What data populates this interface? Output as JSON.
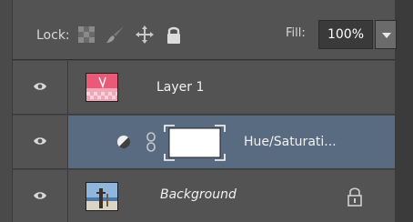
{
  "toolbar": {
    "lock_label": "Lock:",
    "fill_label": "Fill:",
    "fill_value": "100%",
    "icons": [
      "lock-transparent-pixels-icon",
      "lock-image-pixels-icon",
      "lock-position-icon",
      "lock-all-icon"
    ]
  },
  "layers": [
    {
      "name": "Layer 1",
      "visible": true,
      "selected": false,
      "italic": false
    },
    {
      "name": "Hue/Saturati...",
      "visible": true,
      "selected": true,
      "italic": false,
      "adjustment": true
    },
    {
      "name": "Background",
      "visible": true,
      "selected": false,
      "italic": true,
      "locked": true
    }
  ],
  "colors": {
    "panel_bg": "#535353",
    "selected_bg": "#586b80",
    "text": "#f1f1f1"
  }
}
